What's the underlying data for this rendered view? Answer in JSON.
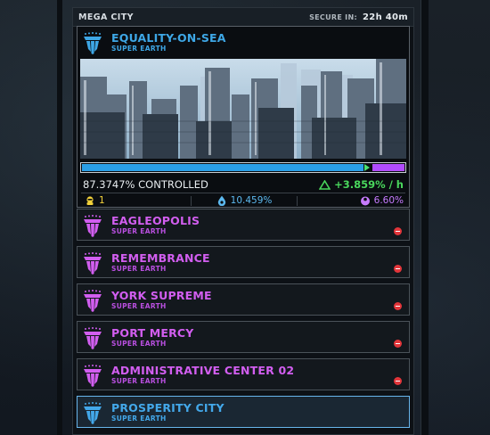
{
  "header": {
    "title": "MEGA CITY",
    "secure_label": "SECURE IN:",
    "secure_time": "22h 40m"
  },
  "featured": {
    "name": "EQUALITY-ON-SEA",
    "planet": "SUPER EARTH",
    "image_icon": "city-skyline-image",
    "progress": {
      "controlled_fraction": 0.873747,
      "controlled_text": "87.3747% CONTROLLED",
      "rate_text": "+3.859% / h"
    },
    "stats": {
      "count": "1",
      "blue_percent": "10.459%",
      "purple_percent": "6.60%"
    }
  },
  "cities": [
    {
      "name": "EAGLEOPOLIS",
      "planet": "SUPER EARTH",
      "status_icon": "blocked-icon"
    },
    {
      "name": "REMEMBRANCE",
      "planet": "SUPER EARTH",
      "status_icon": "blocked-icon"
    },
    {
      "name": "YORK SUPREME",
      "planet": "SUPER EARTH",
      "status_icon": "blocked-icon"
    },
    {
      "name": "PORT MERCY",
      "planet": "SUPER EARTH",
      "status_icon": "blocked-icon"
    },
    {
      "name": "ADMINISTRATIVE CENTER 02",
      "planet": "SUPER EARTH",
      "status_icon": "blocked-icon"
    },
    {
      "name": "PROSPERITY CITY",
      "planet": "SUPER EARTH",
      "selected": true
    }
  ],
  "colors": {
    "accent_blue": "#3ea7e6",
    "accent_purple": "#d25ef0",
    "positive_green": "#49d65c",
    "gold": "#f2d13a",
    "blocked_red": "#e2353a"
  }
}
